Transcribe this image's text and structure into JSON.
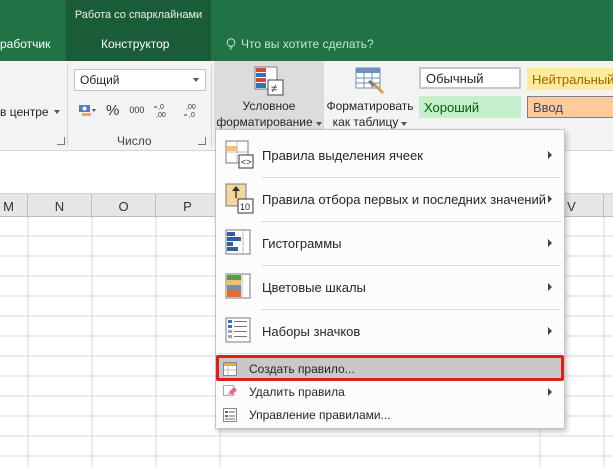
{
  "tabs": {
    "context_group_title": "Работа со спарклайнами",
    "developer_tab": "работчик",
    "constructor_tab": "Конструктор",
    "tell_me": "Что вы хотите сделать?"
  },
  "ribbon": {
    "alignment": {
      "merge_center_label": "в центре"
    },
    "number": {
      "format_value": "Общий",
      "percent_label": "%",
      "thousands_label": "000",
      "group_label": "Число"
    },
    "conditional_formatting": {
      "line1": "Условное",
      "line2": "форматирование"
    },
    "format_as_table": {
      "line1": "Форматировать",
      "line2": "как таблицу"
    },
    "styles": {
      "normal": "Обычный",
      "neutral": "Нейтральный",
      "good": "Хороший",
      "input": "Ввод"
    }
  },
  "grid": {
    "columns": [
      "M",
      "N",
      "O",
      "P",
      "",
      "",
      "",
      "",
      "V"
    ]
  },
  "menu": {
    "items": [
      {
        "label": "Правила выделения ячеек",
        "icon": "highlight-cells-rules-icon",
        "submenu": true
      },
      {
        "label": "Правила отбора первых и последних значений",
        "icon": "top-bottom-rules-icon",
        "submenu": true
      },
      {
        "label": "Гистограммы",
        "icon": "data-bars-icon",
        "submenu": true
      },
      {
        "label": "Цветовые шкалы",
        "icon": "color-scales-icon",
        "submenu": true
      },
      {
        "label": "Наборы значков",
        "icon": "icon-sets-icon",
        "submenu": true
      }
    ],
    "small_items": [
      {
        "label": "Создать правило...",
        "icon": "new-rule-icon",
        "highlighted": true
      },
      {
        "label": "Удалить правила",
        "icon": "clear-rules-icon",
        "submenu": true
      },
      {
        "label": "Управление правилами...",
        "icon": "manage-rules-icon"
      }
    ]
  },
  "colors": {
    "excel_green": "#217346",
    "highlight_box": "#e01d1d"
  }
}
